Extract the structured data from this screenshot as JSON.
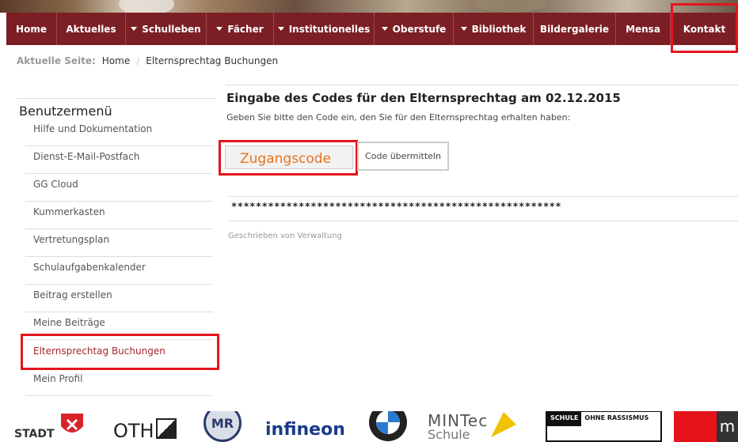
{
  "nav": {
    "items": [
      {
        "label": "Home",
        "dropdown": false
      },
      {
        "label": "Aktuelles",
        "dropdown": false
      },
      {
        "label": "Schulleben",
        "dropdown": true
      },
      {
        "label": "Fächer",
        "dropdown": true
      },
      {
        "label": "Institutionelles",
        "dropdown": true
      },
      {
        "label": "Oberstufe",
        "dropdown": true
      },
      {
        "label": "Bibliothek",
        "dropdown": true
      },
      {
        "label": "Bildergalerie",
        "dropdown": false
      },
      {
        "label": "Mensa",
        "dropdown": false
      },
      {
        "label": "Kontakt",
        "dropdown": false
      }
    ]
  },
  "breadcrumb": {
    "label": "Aktuelle Seite:",
    "items": [
      "Home",
      "Elternsprechtag Buchungen"
    ]
  },
  "sidebar": {
    "title": "Benutzermenü",
    "items": [
      "Hilfe und Dokumentation",
      "Dienst-E-Mail-Postfach",
      "GG Cloud",
      "Kummerkasten",
      "Vertretungsplan",
      "Schulaufgabenkalender",
      "Beitrag erstellen",
      "Meine Beiträge",
      "Elternsprechtag Buchungen",
      "Mein Profil"
    ],
    "active_index": 8
  },
  "main": {
    "title": "Eingabe des Codes für den Elternsprechtag am 02.12.2015",
    "description": "Geben Sie bitte den Code ein, den Sie für den Elternsprechtag erhalten haben:",
    "code_placeholder": "Zugangscode",
    "code_value": "",
    "submit_label": "Code übermitteln",
    "masked_text": "******************************************************",
    "author": "Geschrieben von Verwaltung"
  },
  "logos": {
    "stadt": "STADT",
    "oth": "OTH",
    "mr": "MR",
    "infineon": "infineon",
    "mintec": "MINTec",
    "mintec_sub": "Schule",
    "srsmc_top_left": "SCHULE",
    "srsmc_top_right": "OHNE RASSISMUS",
    "m": "m"
  },
  "colors": {
    "nav_bg": "#7b1f24",
    "accent_red": "#e5141b",
    "active_link": "#a3262c",
    "code_orange": "#e8731a"
  }
}
